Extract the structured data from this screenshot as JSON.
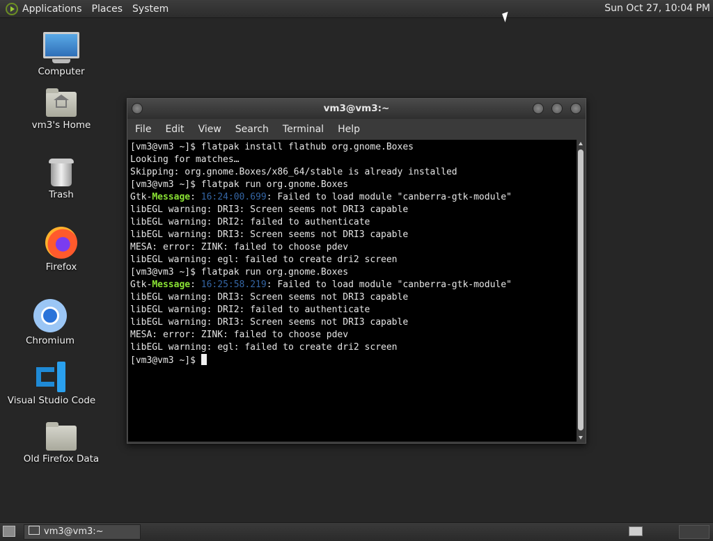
{
  "top_panel": {
    "menus": [
      "Applications",
      "Places",
      "System"
    ],
    "clock": "Sun Oct 27, 10:04 PM"
  },
  "desktop_icons": [
    {
      "label": "Computer",
      "icon": "computer-icon"
    },
    {
      "label": "vm3's Home",
      "icon": "home-folder-icon"
    },
    {
      "label": "Trash",
      "icon": "trash-icon"
    },
    {
      "label": "Firefox",
      "icon": "firefox-icon"
    },
    {
      "label": "Chromium",
      "icon": "chromium-icon"
    },
    {
      "label": "Visual Studio Code",
      "icon": "vscode-icon"
    },
    {
      "label": "Old Firefox Data",
      "icon": "folder-icon"
    }
  ],
  "terminal": {
    "title": "vm3@vm3:~",
    "menus": [
      "File",
      "Edit",
      "View",
      "Search",
      "Terminal",
      "Help"
    ],
    "lines": [
      "[vm3@vm3 ~]$ flatpak install flathub org.gnome.Boxes",
      "Looking for matches…",
      "Skipping: org.gnome.Boxes/x86_64/stable is already installed",
      "[vm3@vm3 ~]$ flatpak run org.gnome.Boxes",
      {
        "prefix": "Gtk-",
        "tag": "Message",
        "sep": ": ",
        "time": "16:24:00.699",
        "rest": ": Failed to load module \"canberra-gtk-module\""
      },
      "libEGL warning: DRI3: Screen seems not DRI3 capable",
      "libEGL warning: DRI2: failed to authenticate",
      "libEGL warning: DRI3: Screen seems not DRI3 capable",
      "MESA: error: ZINK: failed to choose pdev",
      "libEGL warning: egl: failed to create dri2 screen",
      "[vm3@vm3 ~]$ flatpak run org.gnome.Boxes",
      {
        "prefix": "Gtk-",
        "tag": "Message",
        "sep": ": ",
        "time": "16:25:58.219",
        "rest": ": Failed to load module \"canberra-gtk-module\""
      },
      "libEGL warning: DRI3: Screen seems not DRI3 capable",
      "libEGL warning: DRI2: failed to authenticate",
      "libEGL warning: DRI3: Screen seems not DRI3 capable",
      "MESA: error: ZINK: failed to choose pdev",
      "libEGL warning: egl: failed to create dri2 screen"
    ],
    "prompt": "[vm3@vm3 ~]$ "
  },
  "taskbar": {
    "window_button": "vm3@vm3:~"
  },
  "colors": {
    "message_tag": "#8ae234",
    "timestamp": "#3465a4",
    "terminal_bg": "#000000",
    "desktop_bg": "#262626"
  }
}
